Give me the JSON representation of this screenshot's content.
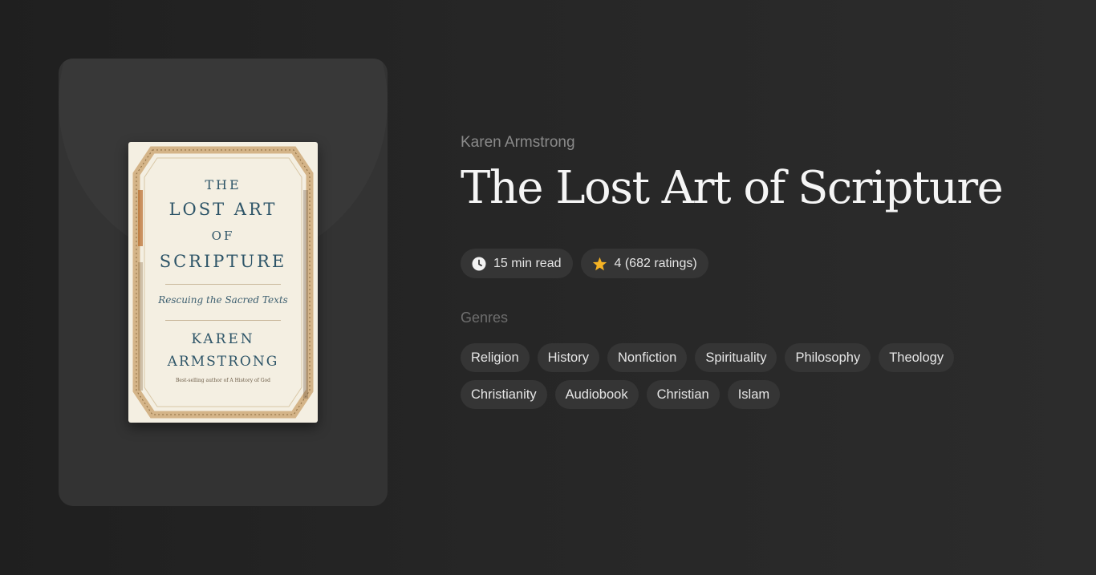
{
  "book": {
    "author": "Karen Armstrong",
    "title": "The Lost Art of Scripture",
    "cover": {
      "line1": "THE",
      "line2": "LOST ART",
      "line3": "OF",
      "line4": "SCRIPTURE",
      "subtitle": "Rescuing the Sacred Texts",
      "author_line1": "KAREN",
      "author_line2": "ARMSTRONG",
      "tagline": "Best-selling author of A History of God"
    }
  },
  "meta": {
    "read_time": "15 min read",
    "rating": "4 (682 ratings)",
    "read_icon": "clock-icon",
    "rating_icon": "star-icon"
  },
  "genres": {
    "heading": "Genres",
    "items": [
      "Religion",
      "History",
      "Nonfiction",
      "Spirituality",
      "Philosophy",
      "Theology",
      "Christianity",
      "Audiobook",
      "Christian",
      "Islam"
    ]
  },
  "colors": {
    "background": "#262626",
    "panel": "#333333",
    "chip": "#353535",
    "star": "#f5b324",
    "cover_text": "#2e5568"
  }
}
